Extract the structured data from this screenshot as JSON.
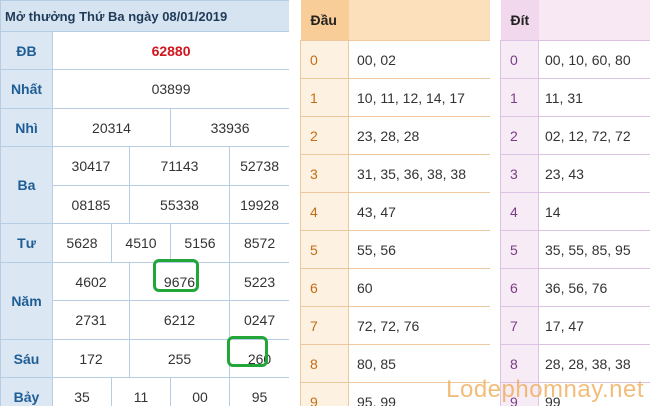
{
  "header": {
    "title": "Mở thưởng Thứ Ba ngày 08/01/2019",
    "dau_label": "Đầu",
    "dit_label": "Đít"
  },
  "results": {
    "db": {
      "label": "ĐB",
      "values": [
        "62880"
      ]
    },
    "nhat": {
      "label": "Nhất",
      "values": [
        "03899"
      ]
    },
    "nhi": {
      "label": "Nhì",
      "values": [
        "20314",
        "33936"
      ]
    },
    "ba": {
      "label": "Ba",
      "values": [
        "30417",
        "71143",
        "52738",
        "08185",
        "55338",
        "19928"
      ]
    },
    "tu": {
      "label": "Tư",
      "values": [
        "5628",
        "4510",
        "5156",
        "8572"
      ]
    },
    "nam": {
      "label": "Năm",
      "values": [
        "4602",
        "9676",
        "5223",
        "2731",
        "6212",
        "0247"
      ]
    },
    "sau": {
      "label": "Sáu",
      "values": [
        "172",
        "255",
        "260"
      ]
    },
    "bay": {
      "label": "Bảy",
      "values": [
        "35",
        "11",
        "00",
        "95"
      ]
    }
  },
  "dau": [
    {
      "digit": "0",
      "numbers": "00, 02"
    },
    {
      "digit": "1",
      "numbers": "10, 11, 12, 14, 17"
    },
    {
      "digit": "2",
      "numbers": "23, 28, 28"
    },
    {
      "digit": "3",
      "numbers": "31, 35, 36, 38, 38"
    },
    {
      "digit": "4",
      "numbers": "43, 47"
    },
    {
      "digit": "5",
      "numbers": "55, 56"
    },
    {
      "digit": "6",
      "numbers": "60"
    },
    {
      "digit": "7",
      "numbers": "72, 72, 76"
    },
    {
      "digit": "8",
      "numbers": "80, 85"
    },
    {
      "digit": "9",
      "numbers": "95, 99"
    }
  ],
  "dit": [
    {
      "digit": "0",
      "numbers": "00, 10, 60, 80"
    },
    {
      "digit": "1",
      "numbers": "11, 31"
    },
    {
      "digit": "2",
      "numbers": "02, 12, 72, 72"
    },
    {
      "digit": "3",
      "numbers": "23, 43"
    },
    {
      "digit": "4",
      "numbers": "14"
    },
    {
      "digit": "5",
      "numbers": "35, 55, 85, 95"
    },
    {
      "digit": "6",
      "numbers": "36, 56, 76"
    },
    {
      "digit": "7",
      "numbers": "17, 47"
    },
    {
      "digit": "8",
      "numbers": "28, 28, 38, 38"
    },
    {
      "digit": "9",
      "numbers": "99"
    }
  ],
  "watermark": "Lodephomnay.net",
  "colors": {
    "highlight_ring": "#22a63a",
    "special_prize": "#d0151d"
  }
}
